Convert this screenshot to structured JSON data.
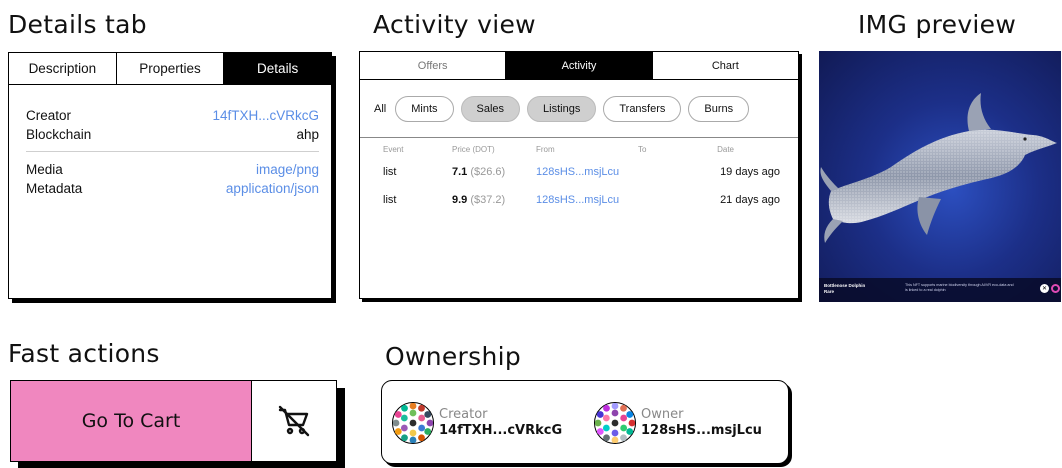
{
  "sections": {
    "details_tab": "Details tab",
    "activity_view": "Activity view",
    "img_preview": "IMG preview",
    "fast_actions": "Fast actions",
    "ownership": "Ownership"
  },
  "details": {
    "tabs": [
      {
        "label": "Description",
        "active": false
      },
      {
        "label": "Properties",
        "active": false
      },
      {
        "label": "Details",
        "active": true
      }
    ],
    "rows": [
      {
        "key": "Creator",
        "value": "14fTXH...cVRkcG",
        "link": true
      },
      {
        "key": "Blockchain",
        "value": "ahp",
        "link": false
      },
      {
        "key": "Media",
        "value": "image/png",
        "link": true
      },
      {
        "key": "Metadata",
        "value": "application/json",
        "link": true
      }
    ]
  },
  "activity": {
    "tabs": [
      {
        "label": "Offers",
        "active": false
      },
      {
        "label": "Activity",
        "active": true
      },
      {
        "label": "Chart",
        "active": false
      }
    ],
    "all_label": "All",
    "filters": [
      {
        "label": "Mints",
        "selected": false
      },
      {
        "label": "Sales",
        "selected": true
      },
      {
        "label": "Listings",
        "selected": true
      },
      {
        "label": "Transfers",
        "selected": false
      },
      {
        "label": "Burns",
        "selected": false
      }
    ],
    "columns": {
      "event": "Event",
      "price": "Price (DOT)",
      "from": "From",
      "to": "To",
      "date": "Date"
    },
    "rows": [
      {
        "event": "list",
        "price": "7.1",
        "usd": "($26.6)",
        "from": "128sHS...msjLcu",
        "to": "",
        "date": "19 days ago"
      },
      {
        "event": "list",
        "price": "9.9",
        "usd": "($37.2)",
        "from": "128sHS...msjLcu",
        "to": "",
        "date": "21 days ago"
      }
    ]
  },
  "preview": {
    "name_line1": "Bottlenose Dolphin",
    "name_line2": "Rare",
    "description": "This NFT supports marine biodiversity through AI/VR eco-data and is linked to a real dolphin",
    "icon_glyph": "✕",
    "icon_name": "close-icon",
    "accent": "#e04bb5"
  },
  "fast_actions": {
    "go_to_cart": "Go To Cart",
    "remove_icon": "cart-remove-icon",
    "accent": "#f087bf"
  },
  "ownership": {
    "creator_label": "Creator",
    "creator_addr": "14fTXH...cVRkcG",
    "owner_label": "Owner",
    "owner_addr": "128sHS...msjLcu"
  },
  "colors": {
    "link": "#5b8ee6",
    "chip_selected": "#cfcfcf"
  }
}
